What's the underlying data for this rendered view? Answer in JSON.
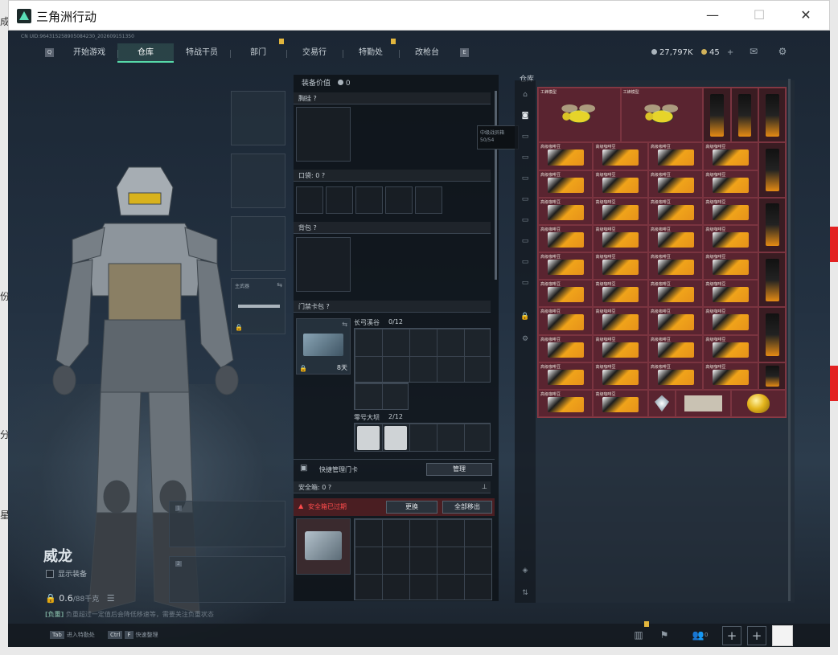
{
  "window": {
    "title": "三角洲行动",
    "minimize": "—",
    "maximize": "☐",
    "close": "✕"
  },
  "topbar": {
    "serial": "CN UID:964315258905084230_202609151350",
    "left_key": "Q",
    "right_key": "E",
    "tabs": [
      "开始游戏",
      "仓库",
      "特战干员",
      "部门",
      "交易行",
      "特勤处",
      "改枪台"
    ],
    "active_tab": "仓库",
    "badged_tabs": [
      "部门",
      "特勤处"
    ],
    "currency_silver": "27,797K",
    "currency_gold": "45",
    "currency_plus": "+",
    "mail_icon": "mail-icon",
    "settings_icon": "gear-icon"
  },
  "character": {
    "name": "威龙",
    "show_equipment_label": "显示装备",
    "weight_value": "0.6",
    "weight_max": "/88千克",
    "tip_prefix": "[负重]",
    "tip_text": "负重超过一定值后会降低移速等，需要关注负重状态",
    "hotkey_1_key": "Tab",
    "hotkey_1_label": "进入特勤处",
    "hotkey_2_key": "Ctrl",
    "hotkey_2_key2": "F",
    "hotkey_2_label": "快速整理",
    "primary_weapon_label": "主武器",
    "slot_number_1": "1",
    "slot_number_2": "2"
  },
  "equipment": {
    "value_label": "装备价值",
    "value": "0",
    "chest_rig": "胸挂",
    "pocket_label": "口袋:",
    "pocket_value": "0",
    "backpack": "背包",
    "keycard_label": "门禁卡包",
    "keycard_duration": "8天",
    "zone1_name": "长弓溪谷",
    "zone1_count": "0/12",
    "zone2_name": "零号大坝",
    "zone2_count": "2/12",
    "quick_manage_label": "快捷管理门卡",
    "manage_button": "管理",
    "safebox_label": "安全箱:",
    "safebox_value": "0",
    "expired_warning": "安全箱已过期",
    "replace_button": "更换",
    "move_all_button": "全部移出",
    "tooltip_line1": "中级战员箱",
    "tooltip_line2": "50/54"
  },
  "storage": {
    "title": "仓库",
    "bee_label": "工蜂模型",
    "coffee_label": "高级咖啡豆",
    "diamond_label": "钻石",
    "paper_label": "文件",
    "egg_label": "金蛋"
  },
  "bottom": {
    "chart_icon": "chart-icon",
    "flag_icon": "flag-icon",
    "friends_icon": "friends-icon",
    "friends_count": "0",
    "plus_1": "+",
    "plus_2": "+"
  },
  "outside": {
    "frag_1": "成",
    "frag_2": "份",
    "frag_3": "分",
    "frag_4": "星"
  }
}
